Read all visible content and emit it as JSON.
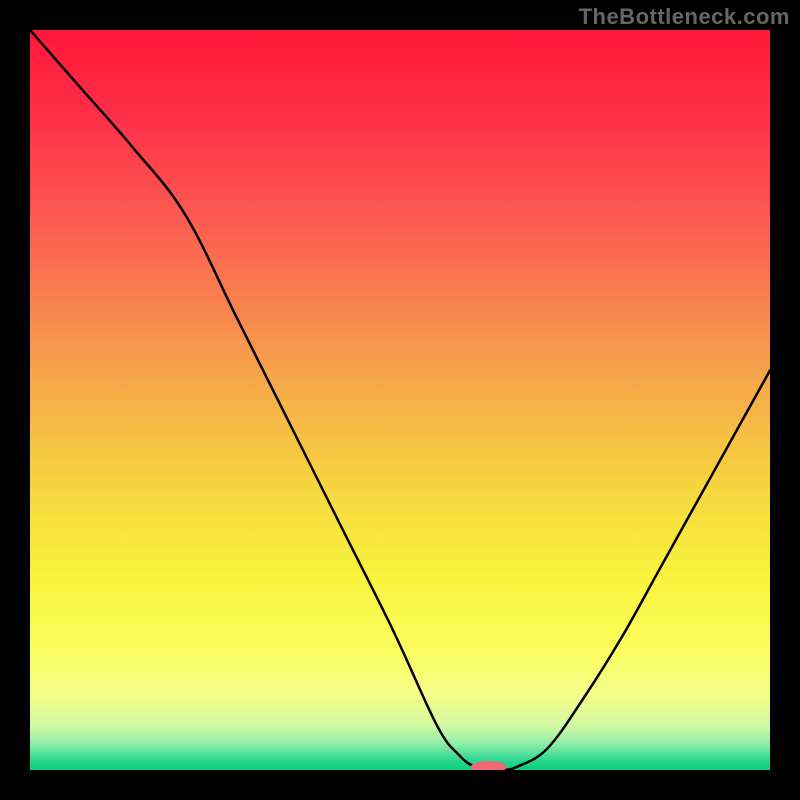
{
  "watermark": "TheBottleneck.com",
  "chart_data": {
    "type": "line",
    "title": "",
    "xlabel": "",
    "ylabel": "",
    "xlim": [
      0,
      100
    ],
    "ylim": [
      0,
      100
    ],
    "series": [
      {
        "name": "bottleneck-curve",
        "x": [
          0,
          7,
          14,
          21,
          28,
          35,
          42,
          49,
          55,
          58,
          60,
          62,
          64,
          66,
          70,
          75,
          80,
          85,
          90,
          95,
          100
        ],
        "y": [
          100,
          92,
          84,
          75,
          61,
          47,
          33,
          19,
          6,
          2,
          0.5,
          0,
          0,
          0.5,
          3,
          10,
          18,
          27,
          36,
          45,
          54
        ]
      }
    ],
    "marker": {
      "name": "optimal-point",
      "x": 62,
      "y": 0,
      "color": "#ef6a74",
      "rx": 18,
      "ry": 6
    },
    "background_gradient": {
      "stops": [
        {
          "pos": 0.0,
          "color": "#ff173a"
        },
        {
          "pos": 0.12,
          "color": "#fe3049"
        },
        {
          "pos": 0.25,
          "color": "#fb5950"
        },
        {
          "pos": 0.38,
          "color": "#f88650"
        },
        {
          "pos": 0.5,
          "color": "#f6b048"
        },
        {
          "pos": 0.62,
          "color": "#f6d63f"
        },
        {
          "pos": 0.74,
          "color": "#f9f33e"
        },
        {
          "pos": 0.84,
          "color": "#fbfe5f"
        },
        {
          "pos": 0.9,
          "color": "#f4fd8b"
        },
        {
          "pos": 0.94,
          "color": "#d2f9a2"
        },
        {
          "pos": 0.965,
          "color": "#8deea8"
        },
        {
          "pos": 0.985,
          "color": "#34d993"
        },
        {
          "pos": 1.0,
          "color": "#09ce7e"
        }
      ]
    }
  }
}
